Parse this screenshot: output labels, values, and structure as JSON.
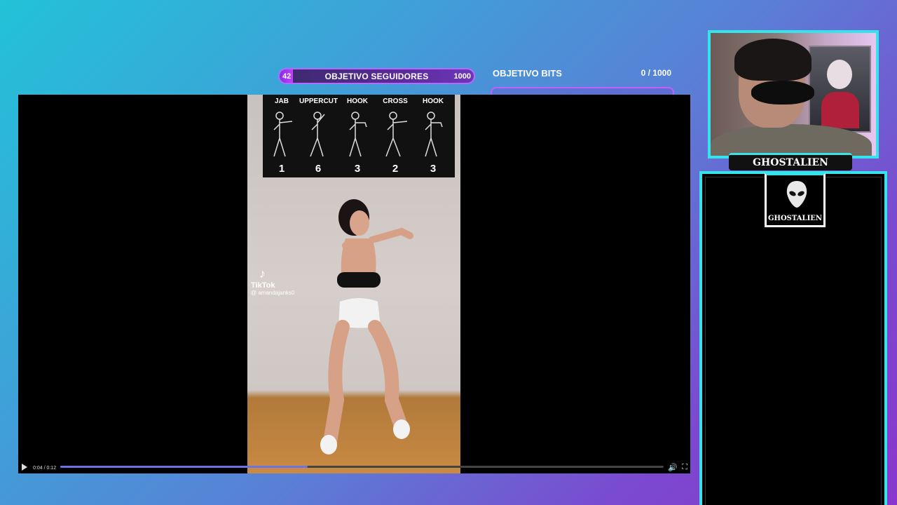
{
  "follower_goal": {
    "current": "42",
    "title": "OBJETIVO SEGUIDORES",
    "target": "1000",
    "progress": 0.042
  },
  "bits_goal": {
    "title": "OBJETIVO BITS",
    "count": "0 / 1000",
    "progress": 0
  },
  "video": {
    "moves": [
      {
        "name": "JAB",
        "count": "1"
      },
      {
        "name": "UPPERCUT",
        "count": "6"
      },
      {
        "name": "HOOK",
        "count": "3"
      },
      {
        "name": "CROSS",
        "count": "2"
      },
      {
        "name": "HOOK",
        "count": "3"
      }
    ],
    "watermark": {
      "brand": "TikTok",
      "handle": "@ amandajanks0"
    },
    "time": "0:04 / 0:12",
    "progress": 0.41
  },
  "webcam": {
    "name": "GHOSTALIEN"
  },
  "logo": {
    "text": "GHOSTALIEN"
  },
  "colors": {
    "accent": "#37e3ea",
    "goal_border": "#b36bff",
    "seek": "#6b73e6"
  }
}
